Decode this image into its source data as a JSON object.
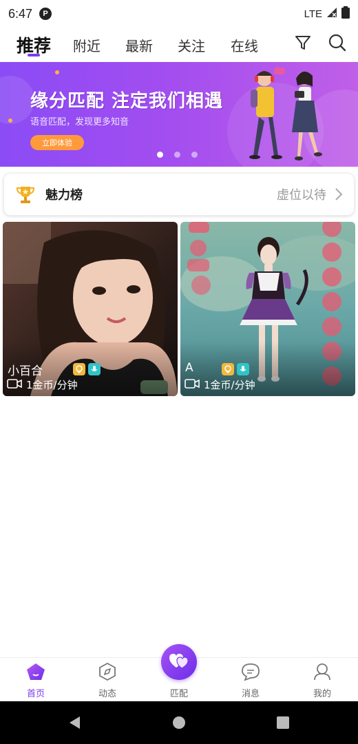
{
  "status_bar": {
    "time": "6:47",
    "notification_icon_letter": "P",
    "network": "LTE"
  },
  "top_tabs": {
    "tabs": [
      {
        "label": "推荐",
        "active": true
      },
      {
        "label": "附近",
        "active": false
      },
      {
        "label": "最新",
        "active": false
      },
      {
        "label": "关注",
        "active": false
      },
      {
        "label": "在线",
        "active": false
      }
    ],
    "icons": [
      "filter-icon",
      "search-icon"
    ]
  },
  "banner": {
    "title": "缘分匹配 注定我们相遇",
    "subtitle": "语音匹配，发现更多知音",
    "button_label": "立即体验",
    "slides_total": 3,
    "slide_active": 1
  },
  "charm_list": {
    "title": "魅力榜",
    "status": "虚位以待",
    "icon": "trophy-icon"
  },
  "users": [
    {
      "name": "小百合",
      "price": "1金币/分钟",
      "badges": [
        "gold-badge-icon",
        "mic-badge-icon"
      ]
    },
    {
      "name": "A",
      "price": "1金币/分钟",
      "badges": [
        "gold-badge-icon",
        "mic-badge-icon"
      ]
    }
  ],
  "bottom_nav": {
    "items": [
      {
        "label": "首页",
        "icon": "home-icon",
        "active": true
      },
      {
        "label": "动态",
        "icon": "compass-icon",
        "active": false
      },
      {
        "label": "匹配",
        "icon": "heart-match-icon",
        "active": false
      },
      {
        "label": "消息",
        "icon": "message-icon",
        "active": false
      },
      {
        "label": "我的",
        "icon": "profile-icon",
        "active": false
      }
    ]
  },
  "colors": {
    "accent": "#7b3bf0",
    "banner_button": "#ff9a3c",
    "muted_text": "#999999"
  }
}
